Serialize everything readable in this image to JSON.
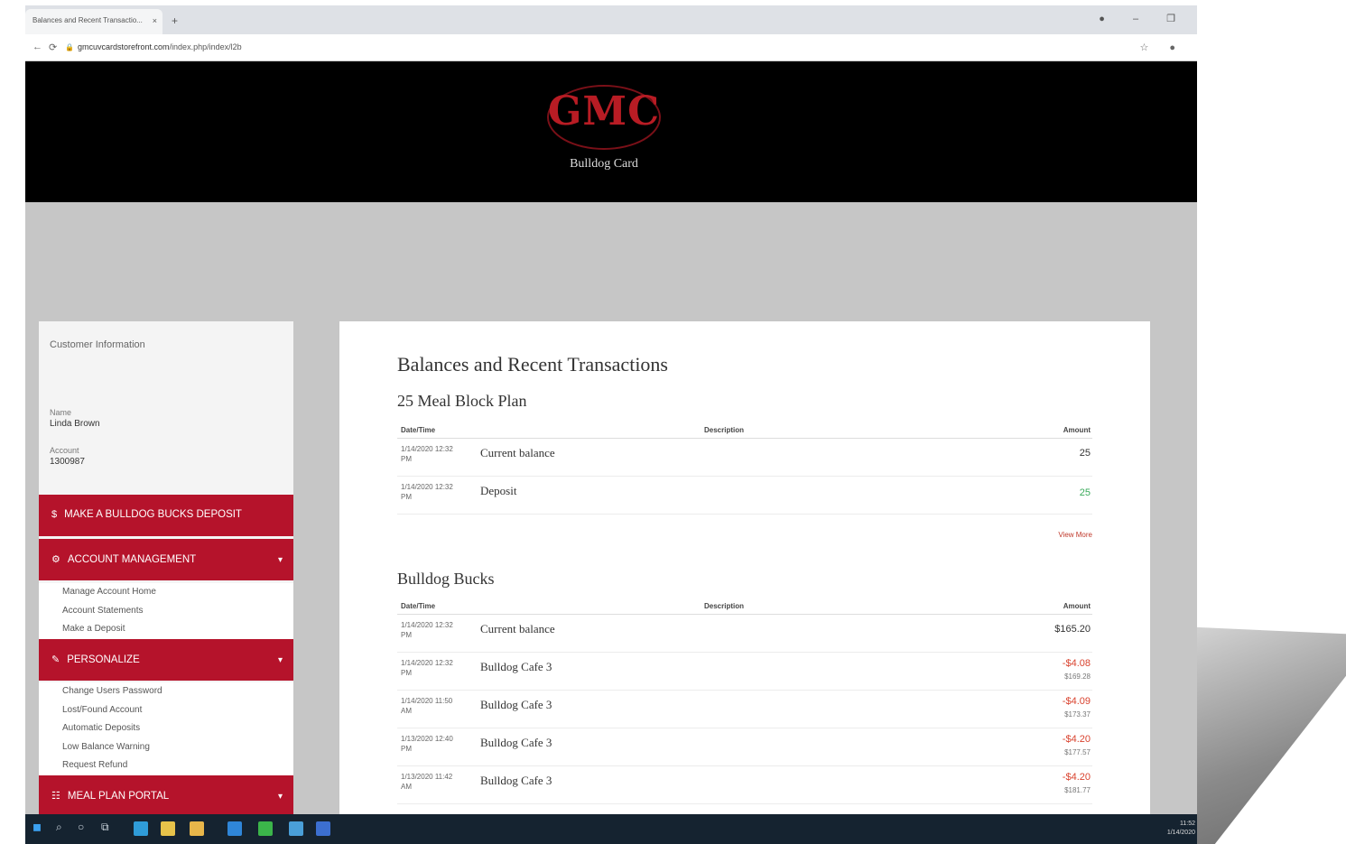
{
  "browser": {
    "tab_title": "Balances and Recent Transactio...",
    "tab_close": "×",
    "new_tab": "+",
    "window_controls": "● – ❐",
    "url_host": "gmcuvcardstorefront.com",
    "url_path": "/index.php/index/l2b",
    "nav_back": "←",
    "nav_reload": "⟳",
    "lock": "🔒",
    "addr_right_icons": "☆ ●"
  },
  "header": {
    "logo_text": "GMC",
    "logo_subtitle": "Bulldog Card"
  },
  "sidebar": {
    "customer_title": "Customer Information",
    "name_label": "Name",
    "name_value": "Linda Brown",
    "account_label": "Account",
    "account_value": "1300987",
    "menu_deposit": {
      "icon": "$",
      "label": "MAKE A BULLDOG BUCKS DEPOSIT"
    },
    "menu_account": {
      "icon": "⚙",
      "label": "ACCOUNT MANAGEMENT",
      "caret": "▾"
    },
    "account_items": [
      "Manage Account Home",
      "Account Statements",
      "Make a Deposit"
    ],
    "menu_personalize": {
      "icon": "✎",
      "label": "PERSONALIZE",
      "caret": "▾"
    },
    "personalize_items": [
      "Change Users Password",
      "Lost/Found Account",
      "Automatic Deposits",
      "Low Balance Warning",
      "Request Refund"
    ],
    "menu_meal": {
      "icon": "☷",
      "label": "MEAL PLAN PORTAL",
      "caret": "▾"
    }
  },
  "main": {
    "page_title": "Balances and Recent Transactions",
    "headers": {
      "date": "Date/Time",
      "description": "Description",
      "amount": "Amount"
    },
    "section1": {
      "title": "25 Meal Block Plan",
      "rows": [
        {
          "date": "1/14/2020 12:32 PM",
          "description": "Current balance",
          "amount": "25",
          "type": "normal"
        },
        {
          "date": "1/14/2020 12:32 PM",
          "description": "Deposit",
          "amount": "25",
          "type": "pos"
        }
      ],
      "view_more": "View More"
    },
    "section2": {
      "title": "Bulldog Bucks",
      "rows": [
        {
          "date": "1/14/2020 12:32 PM",
          "description": "Current balance",
          "amount": "$165.20",
          "type": "normal",
          "sub": ""
        },
        {
          "date": "1/14/2020 12:32 PM",
          "description": "Bulldog Cafe 3",
          "amount": "-$4.08",
          "type": "neg",
          "sub": "$169.28"
        },
        {
          "date": "1/14/2020 11:50 AM",
          "description": "Bulldog Cafe 3",
          "amount": "-$4.09",
          "type": "neg",
          "sub": "$173.37"
        },
        {
          "date": "1/13/2020 12:40 PM",
          "description": "Bulldog Cafe 3",
          "amount": "-$4.20",
          "type": "neg",
          "sub": "$177.57"
        },
        {
          "date": "1/13/2020 11:42 AM",
          "description": "Bulldog Cafe 3",
          "amount": "-$4.20",
          "type": "neg",
          "sub": "$181.77"
        }
      ]
    }
  },
  "taskbar": {
    "search_glyph": "⌕",
    "cortana_glyph": "○",
    "taskview_glyph": "⧉",
    "clock_time": "11:52",
    "clock_date": "1/14/2020",
    "apps": [
      {
        "name": "edge-icon",
        "color": "#2f9cd8"
      },
      {
        "name": "notes-icon",
        "color": "#e6c24a"
      },
      {
        "name": "file-explorer-icon",
        "color": "#e8b64a"
      },
      {
        "name": "mail-icon",
        "color": "#2f86d8"
      },
      {
        "name": "chrome-icon",
        "color": "#3bb54a"
      },
      {
        "name": "photos-icon",
        "color": "#4a9fd8"
      },
      {
        "name": "word-icon",
        "color": "#3c6fd0"
      }
    ]
  }
}
